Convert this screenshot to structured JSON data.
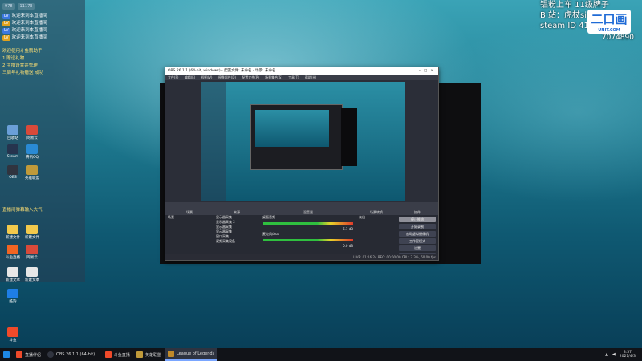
{
  "stream_overlay": {
    "line1": "铝粉上车 11级牌子",
    "line2": "B 站：虎杖sir",
    "line3": "steam ID 410200",
    "number": "7074890",
    "logo_text": "二口画",
    "logo_sub": "UNIT.COM"
  },
  "chat": {
    "tabs": [
      "978",
      "11173"
    ],
    "messages": [
      {
        "badge": "",
        "name": "",
        "text": "欢迎来到本直播间"
      },
      {
        "badge": "",
        "name": "",
        "text": "欢迎来到本直播间"
      },
      {
        "badge": "",
        "name": "",
        "text": "欢迎来到本直播间"
      },
      {
        "badge": "",
        "name": "",
        "text": "欢迎来到本直播间"
      }
    ],
    "notices": [
      "欢迎使用斗鱼鹏助手",
      "1.赠送礼物",
      "2.主播设置并管理",
      "三周年礼物赠送 成功"
    ],
    "footer_line": "直播间弹幕输入大气"
  },
  "desktop": {
    "icons": [
      {
        "label": "回收站",
        "color": "#6a9fd8"
      },
      {
        "label": "网易云",
        "color": "#d94a3a"
      },
      {
        "label": "Steam",
        "color": "#26344e"
      },
      {
        "label": "腾讯QQ",
        "color": "#2a8ad4"
      },
      {
        "label": "OBS",
        "color": "#30343f"
      },
      {
        "label": "英雄联盟",
        "color": "#c09a3a"
      },
      {
        "label": "新建文件",
        "color": "#f2c94c"
      },
      {
        "label": "新建文件",
        "color": "#f2c94c"
      },
      {
        "label": "斗鱼直播",
        "color": "#f26522"
      },
      {
        "label": "网易云",
        "color": "#d94a3a"
      },
      {
        "label": "新建文本",
        "color": "#e7e7e7"
      },
      {
        "label": "新建文本",
        "color": "#e7e7e7"
      },
      {
        "label": "酷狗",
        "color": "#1e7ee6"
      },
      {
        "label": "斗鱼",
        "color": "#ef4a2a"
      }
    ]
  },
  "obs": {
    "title": "OBS 26.1.1 (64-bit, windows) - 配置文件: 未命名 - 场景: 未命名",
    "menu": [
      "文件(F)",
      "编辑(E)",
      "视图(V)",
      "停靠部件(D)",
      "配置文件(P)",
      "场景集合(S)",
      "工具(T)",
      "帮助(H)"
    ],
    "docks": {
      "scenes": {
        "title": "场景",
        "items": [
          "场景"
        ]
      },
      "sources": {
        "title": "来源",
        "items": [
          "显示器采集",
          "显示器采集 2",
          "显示器采集",
          "显示器采集",
          "窗口采集",
          "视频采集设备",
          "图像"
        ]
      },
      "mixer": {
        "title": "混音器",
        "channels": [
          "桌面音频",
          "麦克风/Aux"
        ],
        "levels": [
          "-6.1 dB",
          "0.0 dB"
        ]
      },
      "transitions": {
        "title": "场景转换",
        "value": "淡出"
      },
      "controls": {
        "title": "控件",
        "buttons": [
          "停止推流",
          "开始录制",
          "启动虚拟摄像机",
          "工作室模式",
          "设置",
          "退出"
        ]
      }
    },
    "status": "LIVE: 01:16:24   REC: 00:00:00   CPU: 7.3%, 60.00 fps"
  },
  "taskbar": {
    "tasks": [
      {
        "label": "",
        "icon_color": "#1e88e5"
      },
      {
        "label": "直播伴侣",
        "icon_color": "#ef4a2a"
      },
      {
        "label": "OBS 26.1.1 (64-bit)...",
        "icon_color": "#30343f"
      },
      {
        "label": "斗鱼直播",
        "icon_color": "#ef4a2a"
      },
      {
        "label": "英雄联盟",
        "icon_color": "#c09a3a"
      },
      {
        "label": "League of Legends",
        "icon_color": "#c08a2a"
      }
    ],
    "time": "8:57",
    "date": "2021/4/3"
  }
}
